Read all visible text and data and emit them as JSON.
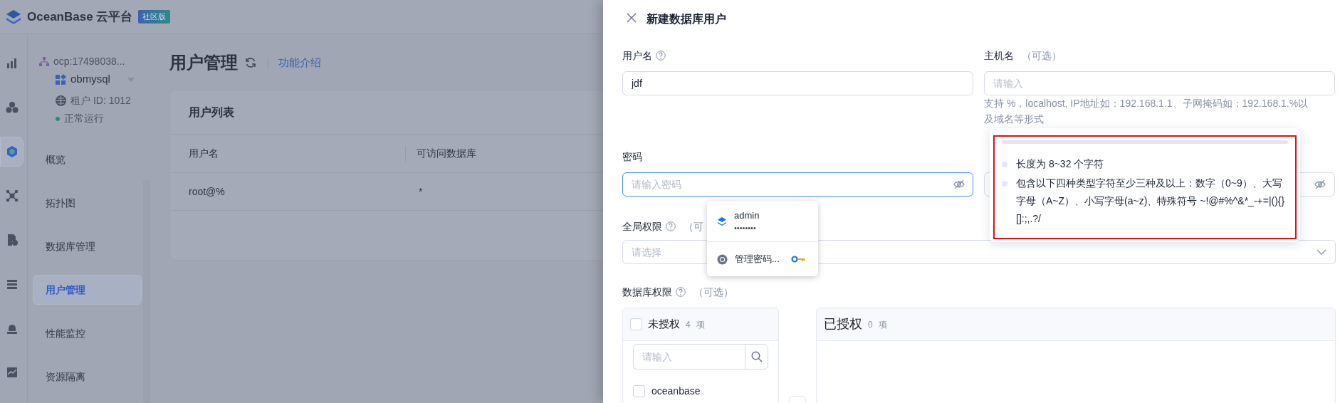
{
  "app": {
    "brand": "OceanBase 云平台",
    "edition": "社区版"
  },
  "rail": [
    {
      "selected": false
    },
    {
      "selected": false
    },
    {
      "selected": true
    },
    {
      "selected": false
    },
    {
      "selected": false
    },
    {
      "selected": false
    },
    {
      "selected": false
    },
    {
      "selected": false
    }
  ],
  "tenant": {
    "cluster": "ocp:17498038...",
    "name": "obmysql",
    "id": "租户 ID: 1012",
    "status": "正常运行"
  },
  "menu": [
    {
      "label": "概览",
      "selected": false
    },
    {
      "label": "拓扑图",
      "selected": false
    },
    {
      "label": "数据库管理",
      "selected": false
    },
    {
      "label": "用户管理",
      "selected": true
    },
    {
      "label": "性能监控",
      "selected": false
    },
    {
      "label": "资源隔离",
      "selected": false
    }
  ],
  "page": {
    "title": "用户管理",
    "link": "功能介绍"
  },
  "user_table": {
    "title": "用户列表",
    "columns": [
      "用户名",
      "可访问数据库"
    ],
    "rows": [
      [
        "root@%",
        "*"
      ]
    ]
  },
  "drawer": {
    "title": "新建数据库用户",
    "username": {
      "label": "用户名",
      "value": "jdf"
    },
    "host": {
      "label": "主机名",
      "optional": "（可选）",
      "placeholder": "请输入",
      "help": "支持 %，localhost, IP地址如：192.168.1.1、子网掩码如：192.168.1.%以及域名等形式"
    },
    "password": {
      "label": "密码",
      "placeholder": "请输入密码",
      "focused": true
    },
    "global": {
      "label": "全局权限",
      "optional": "（可",
      "placeholder": "请选择"
    },
    "db": {
      "label": "数据库权限",
      "optional": "（可选）"
    },
    "transfer": {
      "source": {
        "all_checked": false,
        "title": "未授权",
        "count": "4",
        "unit": "项",
        "search_placeholder": "请输入",
        "items": [
          {
            "label": "oceanbase",
            "checked": false
          }
        ]
      },
      "target": {
        "title": "已授权",
        "count": "0",
        "unit": "项"
      }
    },
    "autofill": {
      "account": "admin",
      "password": "••••••••",
      "manage": "管理密码..."
    },
    "strength_tip": {
      "level": 0,
      "rules": [
        {
          "text": "长度为 8~32 个字符",
          "met": false
        },
        {
          "text": "包含以下四种类型字符至少三种及以上：数字（0~9）、大写字母（A~Z）、小写字母(a~z)、特殊符号 ~!@#%^&*_-+=|(){}[]:;,.?/",
          "met": false
        }
      ]
    }
  }
}
